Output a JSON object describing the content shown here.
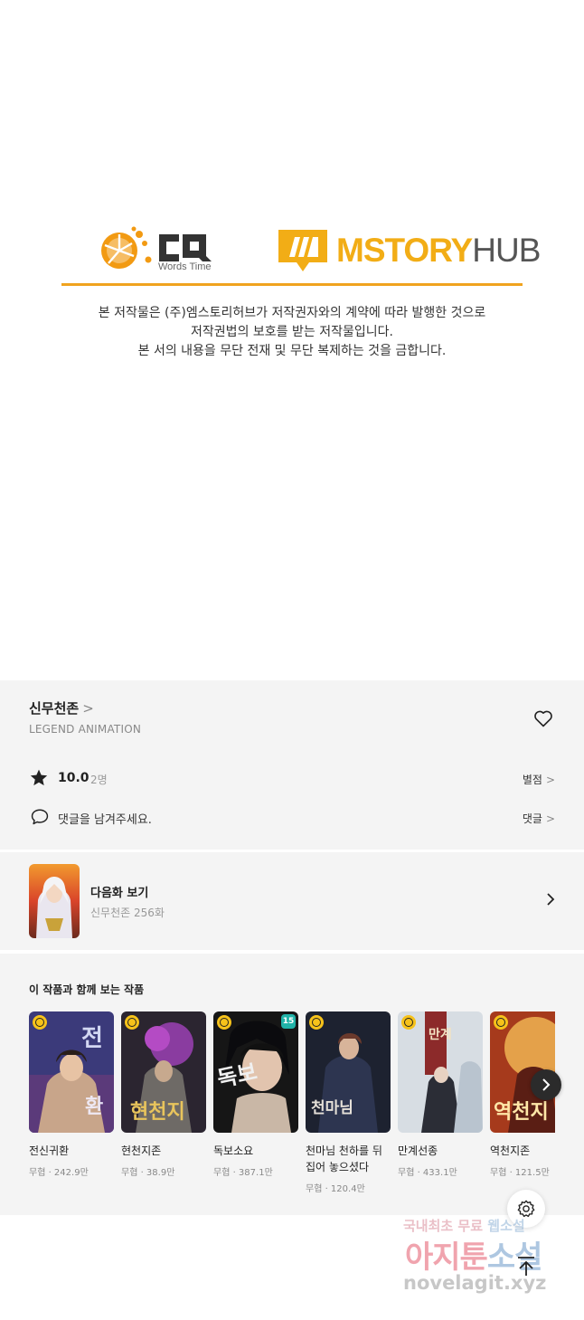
{
  "copyright": {
    "cq_logo": {
      "mark": "CQ",
      "sub": "Words Time"
    },
    "mstory_logo": {
      "main": "MSTORY",
      "hub": "HUB"
    },
    "notice_lines": [
      "본 저작물은 (주)엠스토리허브가 저작권자와의 계약에 따라 발행한 것으로",
      "저작권법의 보호를 받는 저작물입니다.",
      "본 서의 내용을 무단 전재 및 무단 복제하는 것을 금합니다."
    ]
  },
  "work": {
    "title": "신무천존",
    "title_chevron": ">",
    "author": "LEGEND ANIMATION",
    "favorite_icon": "heart-outline-icon",
    "rating": {
      "icon": "star-icon",
      "score": "10.0",
      "count": "2명",
      "link_label": "별점"
    },
    "comment": {
      "icon": "speech-bubble-icon",
      "prompt": "댓글을 남겨주세요.",
      "link_label": "댓글"
    },
    "link_chevron": ">"
  },
  "next_episode": {
    "label": "다음화 보기",
    "subtitle": "신무천존 256화",
    "chevron_icon": "chevron-right-icon"
  },
  "recommendations": {
    "heading": "이 작품과 함께 보는 작품",
    "items": [
      {
        "title": "전신귀환",
        "meta": "무협 · 242.9만",
        "badge": "clock",
        "colors": [
          "#3b3a7a",
          "#c8a58a"
        ]
      },
      {
        "title": "현천지존",
        "meta": "무협 · 38.9만",
        "badge": "clock",
        "colors": [
          "#2b2530",
          "#8a3ca0"
        ]
      },
      {
        "title": "독보소요",
        "meta": "무협 · 387.1만",
        "badge": "clock",
        "age": "15",
        "colors": [
          "#161616",
          "#c9b7a6"
        ]
      },
      {
        "title": "천마님 천하를 뒤집어 놓으셨다",
        "meta": "무협 · 120.4만",
        "badge": "clock",
        "colors": [
          "#1d2230",
          "#6b3a2c"
        ]
      },
      {
        "title": "만계선종",
        "meta": "무협 · 433.1만",
        "badge": "clock",
        "colors": [
          "#b9c4cf",
          "#8c2a2a"
        ]
      },
      {
        "title": "역천지존",
        "meta": "무협 · 121.5만",
        "badge": "clock",
        "colors": [
          "#a63a1c",
          "#e4a14a"
        ]
      }
    ],
    "next_icon": "chevron-right-icon"
  },
  "floating": {
    "settings_icon": "gear-icon",
    "top_icon": "arrow-up-icon"
  },
  "watermark": {
    "line1": "국내최초 무료",
    "line1_hl": "웹소설",
    "line2": "아지툰",
    "line2_hl": "소설",
    "line3": "novelagit.xyz"
  }
}
